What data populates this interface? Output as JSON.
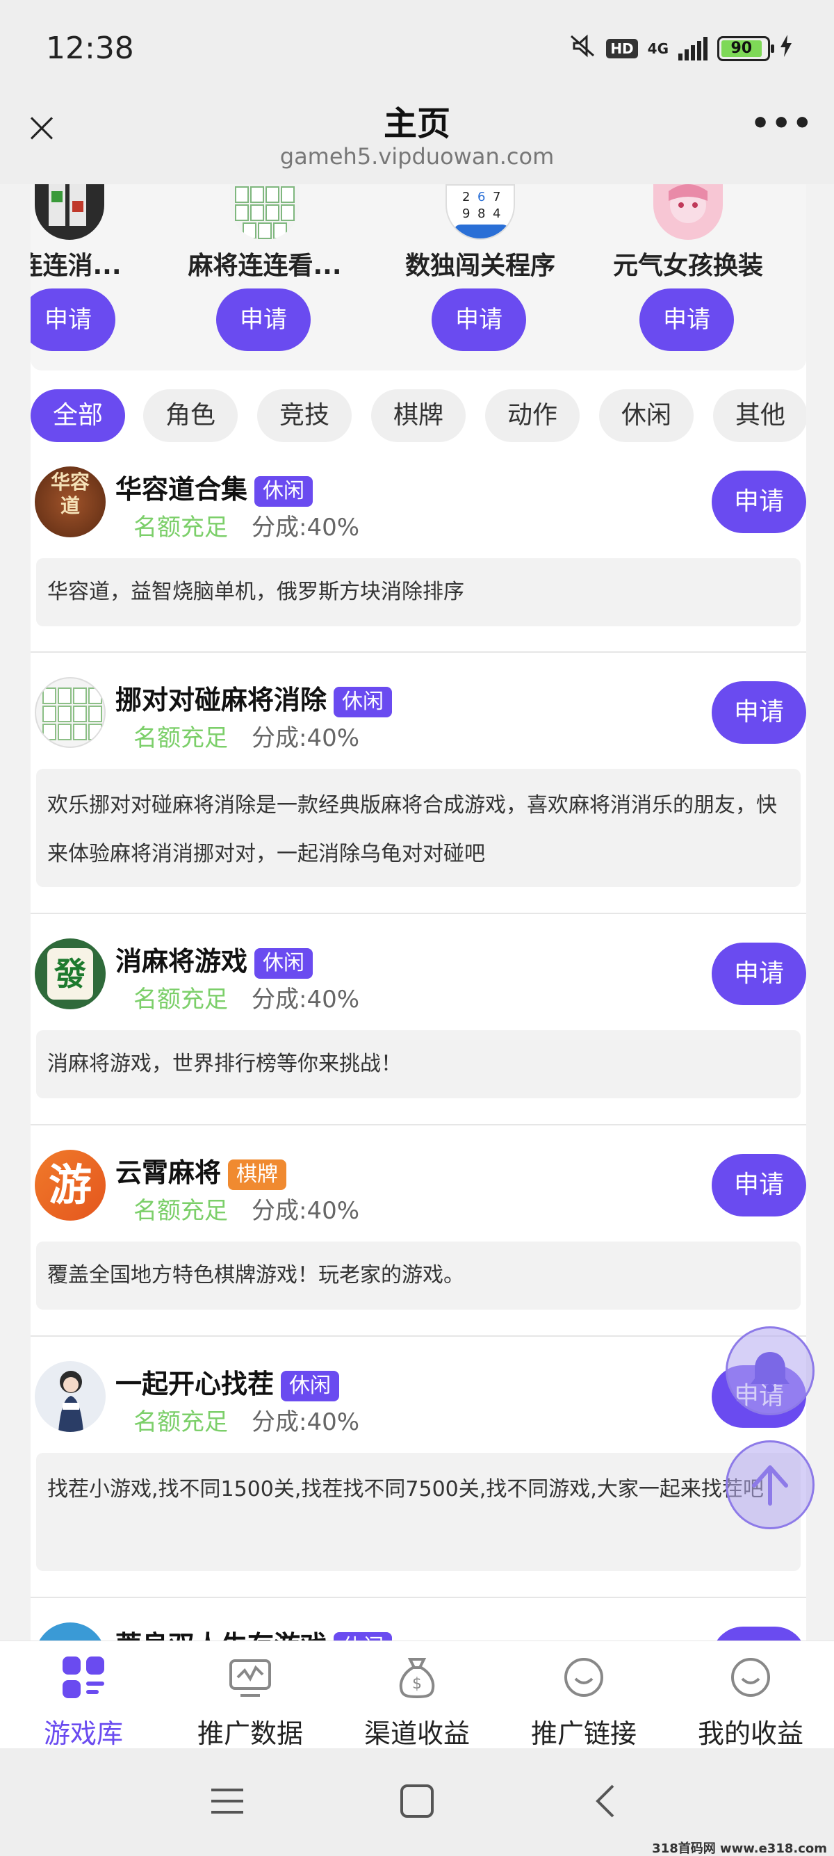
{
  "status_bar": {
    "time": "12:38",
    "hd": "HD",
    "network": "4G",
    "battery": "90"
  },
  "header": {
    "title": "主页",
    "url": "gameh5.vipduowan.com",
    "close_icon": "close-icon",
    "more_icon": "more-icon"
  },
  "carousel": {
    "items": [
      {
        "name": "连连消...",
        "button": "申请"
      },
      {
        "name": "麻将连连看...",
        "button": "申请"
      },
      {
        "name": "数独闯关程序",
        "button": "申请"
      },
      {
        "name": "元气女孩换装",
        "button": "申请"
      }
    ],
    "sudoku_digits": [
      "2",
      "6",
      "7",
      "9",
      "8",
      "4"
    ]
  },
  "categories": [
    "全部",
    "角色",
    "竞技",
    "棋牌",
    "动作",
    "休闲",
    "其他"
  ],
  "active_category": "全部",
  "games": [
    {
      "name": "华容道合集",
      "tag": "休闲",
      "quota": "名额充足",
      "share": "分成:40%",
      "button": "申请",
      "desc": "华容道，益智烧脑单机，俄罗斯方块消除排序",
      "icon_text": "华容道"
    },
    {
      "name": "挪对对碰麻将消除",
      "tag": "休闲",
      "quota": "名额充足",
      "share": "分成:40%",
      "button": "申请",
      "desc": "欢乐挪对对碰麻将消除是一款经典版麻将合成游戏，喜欢麻将消消乐的朋友，快来体验麻将消消挪对对，一起消除乌龟对对碰吧"
    },
    {
      "name": "消麻将游戏",
      "tag": "休闲",
      "quota": "名额充足",
      "share": "分成:40%",
      "button": "申请",
      "desc": "消麻将游戏，世界排行榜等你来挑战！",
      "icon_text": "發"
    },
    {
      "name": "云霄麻将",
      "tag": "棋牌",
      "quota": "名额充足",
      "share": "分成:40%",
      "button": "申请",
      "desc": "覆盖全国地方特色棋牌游戏！玩老家的游戏。",
      "icon_text": "游"
    },
    {
      "name": "一起开心找茬",
      "tag": "休闲",
      "quota": "名额充足",
      "share": "分成:40%",
      "button": "申请",
      "desc": "找茬小游戏,找不同1500关,找茬找不同7500关,找不同游戏,大家一起来找茬吧"
    },
    {
      "name": "蒂良双人生存游戏",
      "tag": "休闲"
    }
  ],
  "tabs": [
    {
      "label": "游戏库",
      "icon": "game-library-icon"
    },
    {
      "label": "推广数据",
      "icon": "chart-icon"
    },
    {
      "label": "渠道收益",
      "icon": "money-bag-icon"
    },
    {
      "label": "推广链接",
      "icon": "smile-icon"
    },
    {
      "label": "我的收益",
      "icon": "smile-icon"
    }
  ],
  "watermark": "318首码网 www.e318.com",
  "colors": {
    "accent": "#6a4bf0",
    "quota_green": "#7ccf6a",
    "chess_tag": "#f08a30"
  }
}
